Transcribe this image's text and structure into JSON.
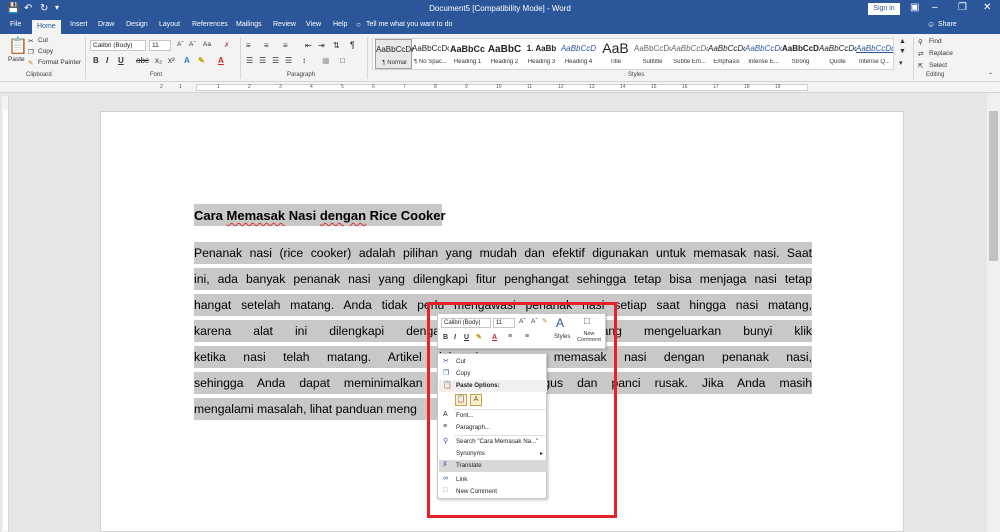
{
  "titlebar": {
    "title": "Document5 [Compatibility Mode]  -  Word",
    "signin": "Sign in",
    "quick_access": [
      "save-icon",
      "undo-icon",
      "redo-icon",
      "customize-icon"
    ],
    "window_controls": [
      "ribbon-options-icon",
      "minimize-icon",
      "restore-icon",
      "close-icon"
    ]
  },
  "tabs": {
    "items": [
      "File",
      "Home",
      "Insert",
      "Draw",
      "Design",
      "Layout",
      "References",
      "Mailings",
      "Review",
      "View",
      "Help"
    ],
    "active": "Home",
    "tellme": "Tell me what you want to do",
    "share": "Share"
  },
  "ribbon": {
    "clipboard": {
      "paste": "Paste",
      "cut": "Cut",
      "copy": "Copy",
      "format_painter": "Format Painter",
      "label": "Clipboard"
    },
    "font": {
      "font_name": "Calibri (Body)",
      "font_size": "11",
      "label": "Font"
    },
    "paragraph": {
      "label": "Paragraph"
    },
    "styles": {
      "label": "Styles",
      "items": [
        {
          "preview": "AaBbCcDc",
          "name": "¶ Normal"
        },
        {
          "preview": "AaBbCcDc",
          "name": "¶ No Spac..."
        },
        {
          "preview": "AaBbCc",
          "name": "Heading 1"
        },
        {
          "preview": "AaBbC",
          "name": "Heading 2"
        },
        {
          "preview": "1. AaBb",
          "name": "Heading 3"
        },
        {
          "preview": "AaBbCcD",
          "name": "Heading 4"
        },
        {
          "preview": "AaB",
          "name": "Title"
        },
        {
          "preview": "AaBbCcDc",
          "name": "Subtitle"
        },
        {
          "preview": "AaBbCcDc",
          "name": "Subtle Em..."
        },
        {
          "preview": "AaBbCcDc",
          "name": "Emphasis"
        },
        {
          "preview": "AaBbCcDc",
          "name": "Intense E..."
        },
        {
          "preview": "AaBbCcDc",
          "name": "Strong"
        },
        {
          "preview": "AaBbCcDc",
          "name": "Quote"
        },
        {
          "preview": "AaBbCcDc",
          "name": "Intense Q..."
        }
      ]
    },
    "editing": {
      "find": "Find",
      "replace": "Replace",
      "select": "Select",
      "label": "Editing"
    }
  },
  "ruler": {
    "numbers": [
      "2",
      "1",
      "1",
      "2",
      "3",
      "4",
      "5",
      "6",
      "7",
      "8",
      "9",
      "10",
      "11",
      "12",
      "13",
      "14",
      "15",
      "16",
      "17",
      "18",
      "19"
    ]
  },
  "document": {
    "heading_words": [
      "Cara",
      "Memasak",
      "Nasi",
      "dengan",
      "Rice",
      "Cooker"
    ],
    "lines": [
      "Penanak nasi (rice cooker) adalah pilihan yang mudah dan efektif digunakan untuk memasak nasi. Saat",
      "ini, ada banyak penanak nasi yang dilengkapi fitur penghangat sehingga tetap bisa menjaga nasi tetap",
      "hangat setelah matang. Anda tidak perlu mengawasi penanak nasi setiap saat hingga nasi matang,",
      "karena alat ini dilengkapi dengan sensor otomatis yang mengeluarkan bunyi klik",
      "ketika nasi telah matang. Artikel ini akan cara memasak nasi dengan penanak nasi,",
      "sehingga Anda dapat meminimalkan kemungkinan hangus dan panci rusak. Jika Anda masih",
      "mengalami masalah, lihat panduan meng"
    ]
  },
  "mini_toolbar": {
    "font_name": "Calibri (Body)",
    "font_size": "11",
    "styles": "Styles",
    "new_comment": "New Comment"
  },
  "context_menu": {
    "cut": "Cut",
    "copy": "Copy",
    "paste_options": "Paste Options:",
    "font": "Font...",
    "paragraph": "Paragraph...",
    "search": "Search \"Cara Memasak Na...\"",
    "synonyms": "Synonyms",
    "translate": "Translate",
    "link": "Link",
    "new_comment": "New Comment"
  },
  "colors": {
    "word_blue": "#2b579a",
    "highlight": "#e8202a",
    "selection": "#c8c8c8"
  }
}
